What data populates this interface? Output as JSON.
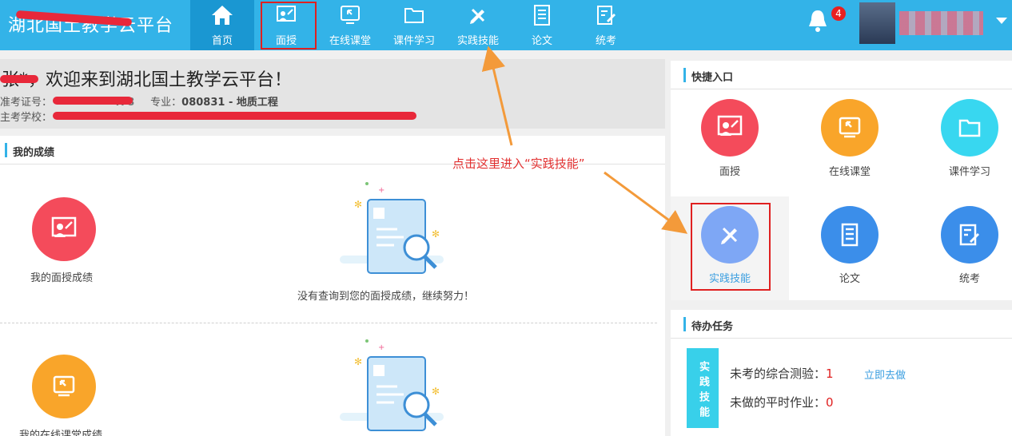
{
  "brand": "湖北国土教学云平台",
  "nav": [
    {
      "label": "首页",
      "icon": "home-icon"
    },
    {
      "label": "面授",
      "icon": "lecture-icon"
    },
    {
      "label": "在线课堂",
      "icon": "online-class-icon"
    },
    {
      "label": "课件学习",
      "icon": "folder-icon"
    },
    {
      "label": "实践技能",
      "icon": "pencil-ruler-icon"
    },
    {
      "label": "论文",
      "icon": "document-icon"
    },
    {
      "label": "统考",
      "icon": "exam-icon"
    }
  ],
  "notifications": {
    "count": "4",
    "icon": "bell-icon"
  },
  "welcome": {
    "title": "张*，欢迎来到湖北国土教学云平台！",
    "exam_no_label": "准考证号：",
    "exam_no_value": "478",
    "major_label": "专业：",
    "major_value": "080831 - 地质工程",
    "school_label": "主考学校："
  },
  "grades": {
    "title": "我的成绩",
    "rows": [
      {
        "label": "我的面授成绩",
        "message": "没有查询到您的面授成绩，继续努力！"
      },
      {
        "label": "我的在线课堂成绩",
        "message": ""
      }
    ]
  },
  "quick_entry": {
    "title": "快捷入口",
    "items": [
      {
        "label": "面授"
      },
      {
        "label": "在线课堂"
      },
      {
        "label": "课件学习"
      },
      {
        "label": "实践技能"
      },
      {
        "label": "论文"
      },
      {
        "label": "统考"
      }
    ]
  },
  "todo": {
    "title": "待办任务",
    "tag": "实践技能",
    "line1_label": "未考的综合测验：",
    "line1_value": "1",
    "line1_link": "立即去做",
    "line2_label": "未做的平时作业：",
    "line2_value": "0"
  },
  "annotation": "点击这里进入“实践技能”",
  "colors": {
    "nav": "#33b3e8",
    "nav_active": "#1a97d2",
    "accent_red": "#e02020",
    "red": "#f44b5b",
    "orange": "#f9a52a",
    "cyan": "#38d7f0",
    "blue": "#3b8eea",
    "lilac": "#7ea7f5"
  }
}
